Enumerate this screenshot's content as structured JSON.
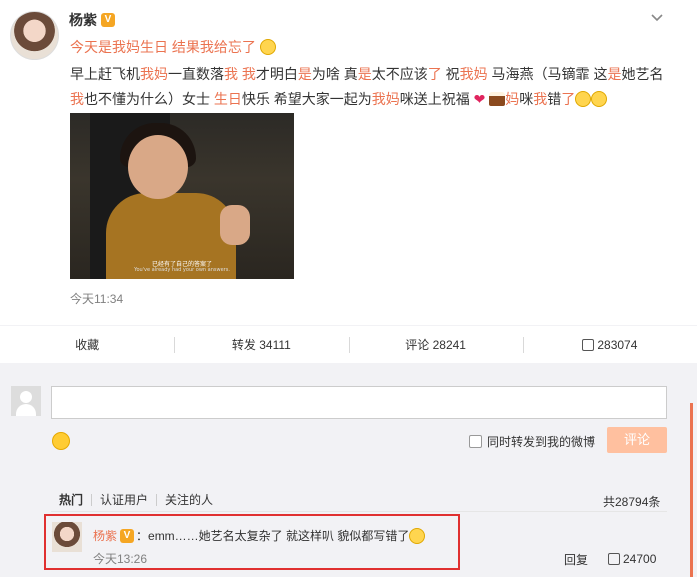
{
  "post": {
    "author": "杨紫",
    "badge": "V",
    "headline": "今天是我妈生日 结果我给忘了",
    "body_segments": [
      {
        "t": "早上赶飞机",
        "red": false
      },
      {
        "t": "我妈",
        "red": true
      },
      {
        "t": "一直数落",
        "red": false
      },
      {
        "t": "我 我",
        "red": true
      },
      {
        "t": "才明白",
        "red": false
      },
      {
        "t": "是",
        "red": true
      },
      {
        "t": "为啥 真",
        "red": false
      },
      {
        "t": "是",
        "red": true
      },
      {
        "t": "太不应该",
        "red": false
      },
      {
        "t": "了",
        "red": true
      },
      {
        "t": " 祝",
        "red": false
      },
      {
        "t": "我妈",
        "red": true
      },
      {
        "t": " 马海燕（马镝霏 这",
        "red": false
      },
      {
        "t": "是",
        "red": true
      },
      {
        "t": "她艺名 ",
        "red": false
      },
      {
        "t": "我",
        "red": true
      },
      {
        "t": "也不懂为什么）女士 ",
        "red": false
      },
      {
        "t": "生日",
        "red": true
      },
      {
        "t": "快乐 希望大家一起为",
        "red": false
      },
      {
        "t": "我妈",
        "red": true
      },
      {
        "t": "咪送上祝福 ",
        "red": false
      }
    ],
    "tail_1": "妈",
    "tail_2": "咪",
    "tail_3": "我",
    "tail_4": "错",
    "tail_5": "了",
    "photo_subtitle_cn": "已经有了自己的答案了",
    "photo_subtitle_en": "You've already had your own answers.",
    "time": "今天11:34"
  },
  "actions": {
    "favorite": "收藏",
    "repost": "转发 34111",
    "comment": "评论 28241",
    "likes": "283074"
  },
  "composer": {
    "forward_label": "同时转发到我的微博",
    "submit": "评论"
  },
  "tabs": {
    "hot": "热门",
    "verified": "认证用户",
    "following": "关注的人",
    "total": "共28794条"
  },
  "comment": {
    "author": "杨紫",
    "badge": "V",
    "text": "：emm……她艺名太复杂了 就这样叭 貌似都写错了",
    "time": "今天13:26",
    "reply": "回复",
    "likes": "24700"
  }
}
